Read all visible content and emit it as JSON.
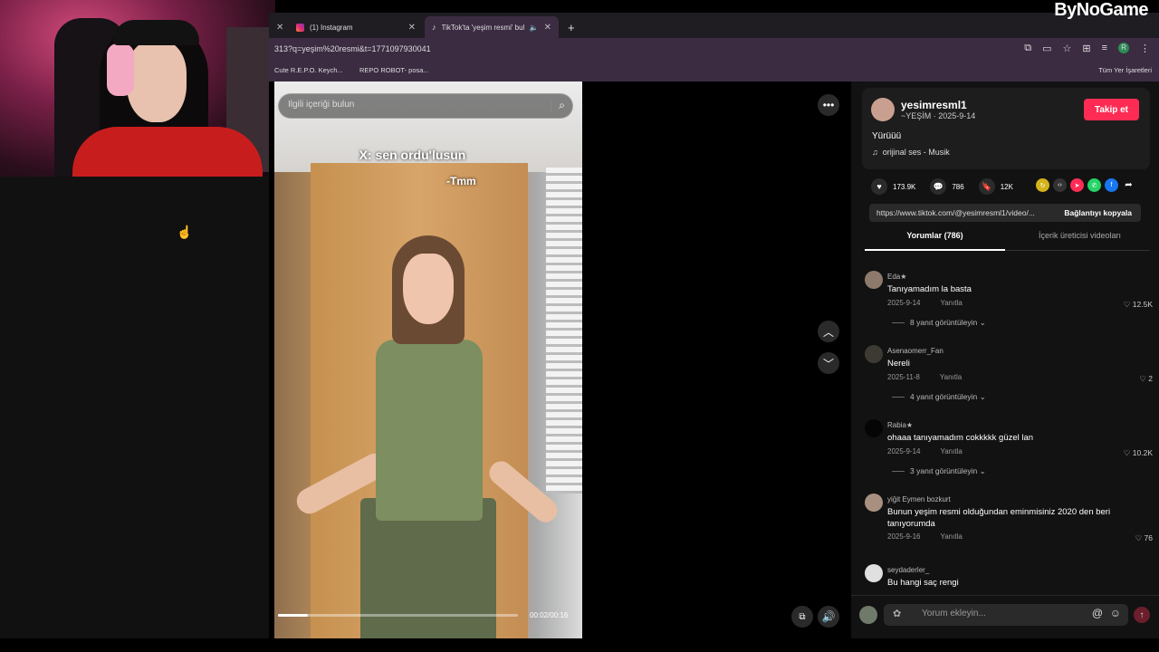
{
  "watermark": "ByNoGame",
  "browser": {
    "tabs": [
      {
        "label": "(1) Instagram"
      },
      {
        "label": "TikTok'ta 'yeşim resmi' bula"
      }
    ],
    "url": "313?q=yeşim%20resmi&t=1771097930041",
    "bookmarks": [
      "Cute R.E.P.O. Keych...",
      "REPO ROBOT- posa..."
    ],
    "bookmarks_all": "Tüm Yer İşaretleri"
  },
  "search": {
    "placeholder": "İlgili içeriği bulun"
  },
  "video": {
    "caption_top": "X: sen ordu'lusun",
    "caption_reply": "-Tmm",
    "time": "00:02/00:16",
    "progress": 0.125
  },
  "post": {
    "username": "yesimresml1",
    "subline": "~YEŞİM · 2025-9-14",
    "follow_label": "Takip et",
    "description": "Yürüüü",
    "music": "orijinal ses - Musik",
    "likes": "173.9K",
    "comments_count": "786",
    "saves": "12K",
    "link": "https://www.tiktok.com/@yesimresml1/video/...",
    "copy_link_label": "Bağlantıyı kopyala",
    "tab_comments": "Yorumlar (786)",
    "tab_creator": "İçerik üreticisi videoları"
  },
  "comments": [
    {
      "user": "Eda★",
      "text": "Tanıyamadım la basta",
      "date": "2025-9-14",
      "reply": "Yanıtla",
      "likes": "12.5K",
      "more": "8 yanıt görüntüleyin"
    },
    {
      "user": "Asenaomerr_Fan",
      "text": "Nereli",
      "date": "2025-11-8",
      "reply": "Yanıtla",
      "likes": "2",
      "more": "4 yanıt görüntüleyin"
    },
    {
      "user": "Rabia★",
      "text": "ohaaa tanıyamadım cokkkkk güzel lan",
      "date": "2025-9-14",
      "reply": "Yanıtla",
      "likes": "10.2K",
      "more": "3 yanıt görüntüleyin"
    },
    {
      "user": "yiğit Eymen bozkurt",
      "text": "Bunun yeşim resmi olduğundan eminmisiniz 2020 den beri tanıyorumda",
      "date": "2025-9-16",
      "reply": "Yanıtla",
      "likes": "76"
    },
    {
      "user": "seydaderler_",
      "text": "Bu hangi saç rengi"
    }
  ],
  "comment_input": {
    "placeholder": "Yorum ekleyin..."
  },
  "icons": {
    "more": "ellipsis-icon",
    "up": "chevron-up-icon",
    "down": "chevron-down-icon",
    "volume": "volume-icon",
    "pip": "picture-in-picture-icon"
  },
  "colors": {
    "accent": "#fe2c55",
    "browser_chrome": "#3b2c42"
  }
}
